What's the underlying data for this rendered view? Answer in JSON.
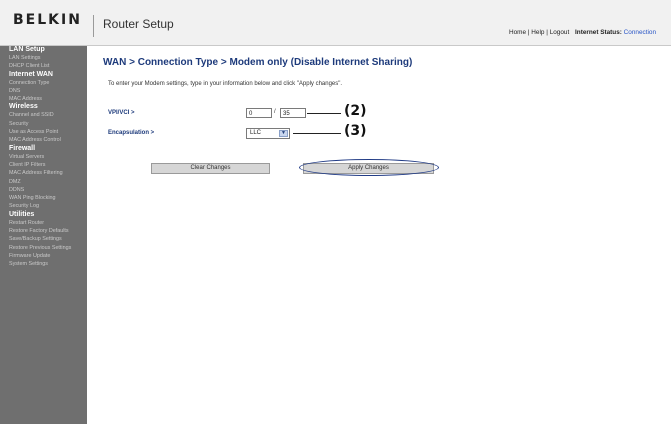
{
  "header": {
    "logo": "BELKIN",
    "title": "Router Setup",
    "links": {
      "home": "Home",
      "help": "Help",
      "logout": "Logout",
      "sep": "|"
    },
    "status_label": "Internet Status:",
    "status_value": "Connection"
  },
  "sidebar": {
    "sections": [
      {
        "title": "LAN Setup",
        "items": [
          "LAN Settings",
          "DHCP Client List"
        ]
      },
      {
        "title": "Internet WAN",
        "items": [
          "Connection Type",
          "DNS",
          "MAC Address"
        ]
      },
      {
        "title": "Wireless",
        "items": [
          "Channel and SSID",
          "Security",
          "Use as Access Point",
          "MAC Address Control"
        ]
      },
      {
        "title": "Firewall",
        "items": [
          "Virtual Servers",
          "Client IP Filters",
          "MAC Address Filtering",
          "DMZ",
          "DDNS",
          "WAN Ping Blocking",
          "Security Log"
        ]
      },
      {
        "title": "Utilities",
        "items": [
          "Restart Router",
          "Restore Factory Defaults",
          "Save/Backup Settings",
          "Restore Previous Settings",
          "Firmware Update",
          "System Settings"
        ]
      }
    ]
  },
  "main": {
    "title": "WAN > Connection Type > Modem only (Disable Internet Sharing)",
    "intro": "To enter your Modem settings, type in your information below and click \"Apply changes\".",
    "vpivci": {
      "label": "VPI/VCI >",
      "vpi": "0",
      "separator": "/",
      "vci": "35"
    },
    "encapsulation": {
      "label": "Encapsulation >",
      "value": "LLC"
    },
    "callouts": {
      "vpivci": "(2)",
      "encap": "(3)"
    },
    "buttons": {
      "clear": "Clear Changes",
      "apply": "Apply Changes"
    }
  },
  "colors": {
    "sidebar_bg": "#6f6f6f",
    "title_blue": "#1d3a7b",
    "status_blue": "#2855c6",
    "highlight_ellipse": "#223c86"
  },
  "icons": {
    "select_arrow": "chevron-down-icon"
  }
}
